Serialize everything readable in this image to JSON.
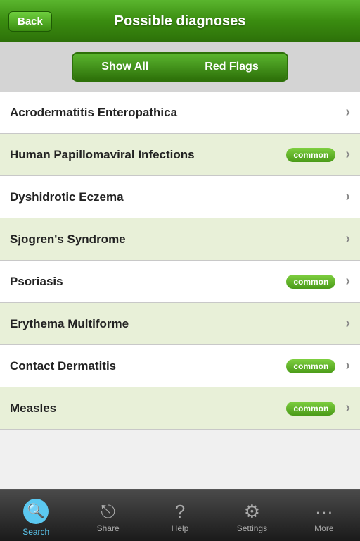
{
  "header": {
    "back_label": "Back",
    "title": "Possible diagnoses"
  },
  "toggle": {
    "show_all_label": "Show All",
    "red_flags_label": "Red Flags",
    "active": "show_all"
  },
  "diagnoses": [
    {
      "name": "Acrodermatitis Enteropathica",
      "common": false
    },
    {
      "name": "Human Papillomaviral Infections",
      "common": true
    },
    {
      "name": "Dyshidrotic Eczema",
      "common": false
    },
    {
      "name": "Sjogren's Syndrome",
      "common": false
    },
    {
      "name": "Psoriasis",
      "common": true
    },
    {
      "name": "Erythema Multiforme",
      "common": false
    },
    {
      "name": "Contact Dermatitis",
      "common": true
    },
    {
      "name": "Measles",
      "common": true
    }
  ],
  "common_label": "common",
  "tabs": [
    {
      "id": "search",
      "label": "Search",
      "icon": "🔍",
      "active": true
    },
    {
      "id": "share",
      "label": "Share",
      "icon": "↗",
      "active": false
    },
    {
      "id": "help",
      "label": "Help",
      "icon": "?",
      "active": false
    },
    {
      "id": "settings",
      "label": "Settings",
      "icon": "⚙",
      "active": false
    },
    {
      "id": "more",
      "label": "More",
      "icon": "···",
      "active": false
    }
  ]
}
